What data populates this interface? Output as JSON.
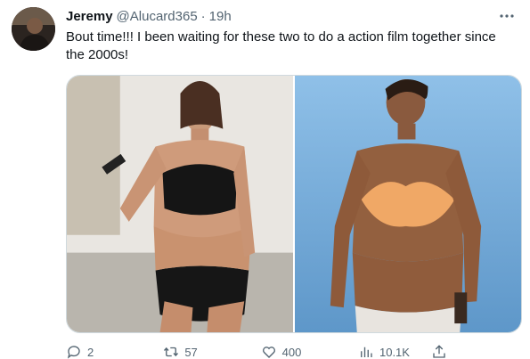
{
  "tweet": {
    "author_name": "Jeremy",
    "handle": "@Alucard365",
    "separator": "·",
    "time": "19h",
    "text": "Bout time!!! I been waiting for these two to do a action film together since the 2000s!",
    "more_icon": "more-horizontal-icon"
  },
  "media": {
    "images": [
      {
        "name": "left-photo"
      },
      {
        "name": "right-photo"
      }
    ]
  },
  "actions": {
    "reply_count": "2",
    "retweet_count": "57",
    "like_count": "400",
    "views_count": "10.1K",
    "icons": [
      "reply-icon",
      "retweet-icon",
      "like-icon",
      "views-icon",
      "share-icon"
    ],
    "icon_color": "#536471"
  }
}
